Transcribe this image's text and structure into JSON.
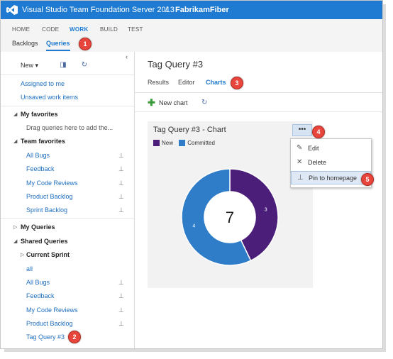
{
  "header": {
    "product": "Visual Studio Team Foundation Server 2013",
    "separator": "/",
    "project": "FabrikamFiber"
  },
  "hubs": {
    "items": [
      {
        "label": "HOME"
      },
      {
        "label": "CODE"
      },
      {
        "label": "WORK"
      },
      {
        "label": "BUILD"
      },
      {
        "label": "TEST"
      }
    ],
    "active": "WORK",
    "sub": [
      {
        "label": "Backlogs"
      },
      {
        "label": "Queries"
      }
    ]
  },
  "badges": [
    "1",
    "2",
    "3",
    "4",
    "5"
  ],
  "left": {
    "new_label": "New",
    "links": [
      {
        "label": "Assigned to me"
      },
      {
        "label": "Unsaved work items"
      }
    ],
    "my_favorites": {
      "title": "My favorites",
      "hint": "Drag queries here to add the..."
    },
    "team_favorites": {
      "title": "Team favorites",
      "items": [
        "All Bugs",
        "Feedback",
        "My Code Reviews",
        "Product Backlog",
        "Sprint Backlog"
      ]
    },
    "my_queries": {
      "title": "My Queries"
    },
    "shared_queries": {
      "title": "Shared Queries",
      "current_sprint": "Current Sprint",
      "items": [
        "all",
        "All Bugs",
        "Feedback",
        "My Code Reviews",
        "Product Backlog",
        "Tag Query #3"
      ]
    }
  },
  "main": {
    "title": "Tag Query #3",
    "tabs": [
      {
        "label": "Results"
      },
      {
        "label": "Editor"
      },
      {
        "label": "Charts"
      }
    ],
    "new_chart_label": "New chart",
    "tile": {
      "title": "Tag Query #3 - Chart",
      "ellipsis": "•••",
      "total": "7"
    },
    "menu": {
      "items": [
        {
          "label": "Edit",
          "icon": "pencil-icon"
        },
        {
          "label": "Delete",
          "icon": "x-icon"
        },
        {
          "label": "Pin to homepage",
          "icon": "pin-icon"
        }
      ]
    }
  },
  "colors": {
    "accent": "#1e7bd1",
    "new": "#4b1e7a",
    "committed": "#2f7dc9"
  },
  "chart_data": {
    "type": "pie",
    "title": "Tag Query #3 - Chart",
    "categories": [
      "New",
      "Committed"
    ],
    "values": [
      3,
      4
    ],
    "total": 7
  }
}
